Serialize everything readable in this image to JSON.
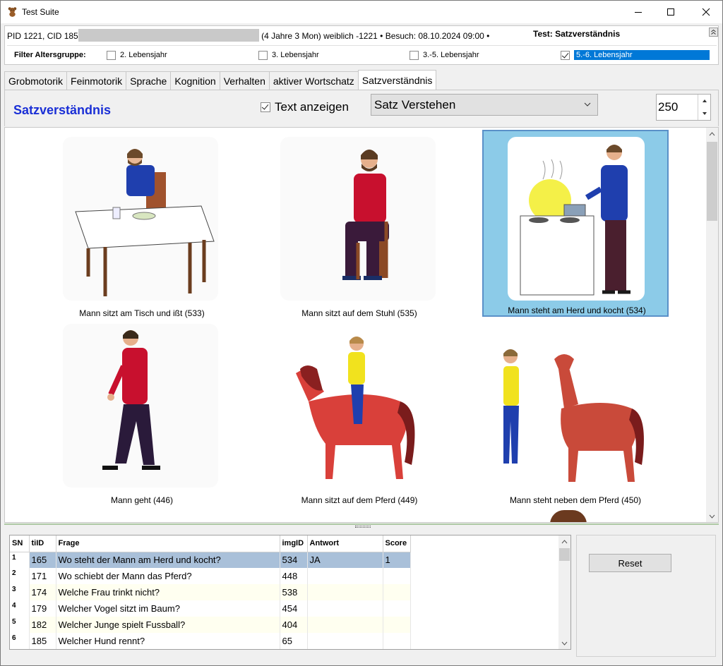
{
  "window": {
    "title": "Test Suite"
  },
  "patient": {
    "id_text": "PID 1221, CID 185",
    "details": "(4 Jahre 3 Mon) weiblich -1221 • Besuch: 08.10.2024 09:00 •",
    "test_label": "Test: Satzverständnis"
  },
  "filter": {
    "label": "Filter Altersgruppe:",
    "options": [
      {
        "label": "2. Lebensjahr",
        "checked": false
      },
      {
        "label": "3. Lebensjahr",
        "checked": false
      },
      {
        "label": "3.-5. Lebensjahr",
        "checked": false
      },
      {
        "label": "5.-6. Lebensjahr",
        "checked": true
      }
    ]
  },
  "tabs": [
    {
      "label": "Grobmotorik"
    },
    {
      "label": "Feinmotorik"
    },
    {
      "label": "Sprache"
    },
    {
      "label": "Kognition"
    },
    {
      "label": "Verhalten"
    },
    {
      "label": "aktiver Wortschatz"
    },
    {
      "label": "Satzverständnis",
      "active": true
    }
  ],
  "toolbar": {
    "section_title": "Satzverständnis",
    "show_text_label": "Text anzeigen",
    "show_text_checked": true,
    "dropdown_value": "Satz Verstehen",
    "spinner_value": "250"
  },
  "gallery": {
    "items": [
      {
        "caption": "Mann sitzt am Tisch und ißt (533)",
        "selected": false
      },
      {
        "caption": "Mann sitzt auf dem Stuhl (535)",
        "selected": false
      },
      {
        "caption": "Mann steht am Herd und kocht (534)",
        "selected": true
      },
      {
        "caption": "Mann geht (446)",
        "selected": false
      },
      {
        "caption": "Mann sitzt auf dem Pferd (449)",
        "selected": false
      },
      {
        "caption": "Mann steht neben dem Pferd (450)",
        "selected": false
      }
    ]
  },
  "table": {
    "headers": [
      "SN",
      "tiID",
      "Frage",
      "imgID",
      "Antwort",
      "Score"
    ],
    "rows": [
      {
        "sn": "1",
        "tiid": "165",
        "frage": "Wo steht der Mann am Herd und kocht?",
        "imgid": "534",
        "antwort": "JA",
        "score": "1"
      },
      {
        "sn": "2",
        "tiid": "171",
        "frage": "Wo schiebt der Mann das Pferd?",
        "imgid": "448",
        "antwort": "",
        "score": ""
      },
      {
        "sn": "3",
        "tiid": "174",
        "frage": "Welche Frau trinkt nicht?",
        "imgid": "538",
        "antwort": "",
        "score": ""
      },
      {
        "sn": "4",
        "tiid": "179",
        "frage": "Welcher Vogel sitzt im Baum?",
        "imgid": "454",
        "antwort": "",
        "score": ""
      },
      {
        "sn": "5",
        "tiid": "182",
        "frage": "Welcher Junge spielt Fussball?",
        "imgid": "404",
        "antwort": "",
        "score": ""
      },
      {
        "sn": "6",
        "tiid": "185",
        "frage": "Welcher Hund rennt?",
        "imgid": "65",
        "antwort": "",
        "score": ""
      }
    ]
  },
  "reset_label": "Reset",
  "colors": {
    "accent_title": "#1a2fd6",
    "selection": "#0078d7",
    "selected_card": "#8ccbe8",
    "selected_row": "#a9c0d9"
  }
}
